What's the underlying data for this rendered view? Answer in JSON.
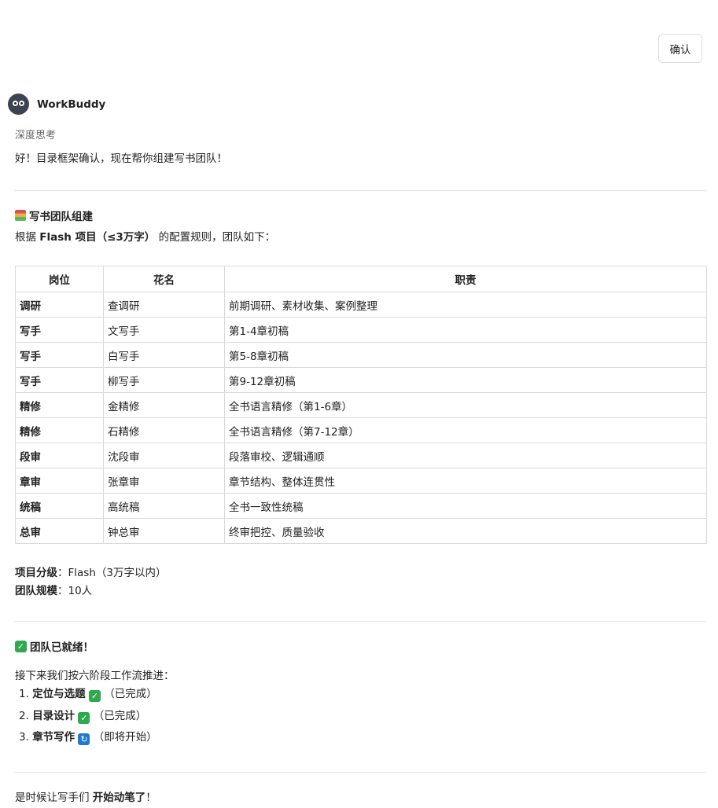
{
  "confirm_button": "确认",
  "agent": {
    "name": "WorkBuddy",
    "thinking_label": "深度思考"
  },
  "intro": "好！目录框架确认，现在帮你组建写书团队！",
  "team_section": {
    "title": "写书团队组建",
    "desc_prefix": "根据 ",
    "desc_bold": "Flash 项目（≤3万字）",
    "desc_suffix": " 的配置规则，团队如下："
  },
  "table": {
    "headers": [
      "岗位",
      "花名",
      "职责"
    ],
    "rows": [
      [
        "调研",
        "查调研",
        "前期调研、素材收集、案例整理"
      ],
      [
        "写手",
        "文写手",
        "第1-4章初稿"
      ],
      [
        "写手",
        "白写手",
        "第5-8章初稿"
      ],
      [
        "写手",
        "柳写手",
        "第9-12章初稿"
      ],
      [
        "精修",
        "金精修",
        "全书语言精修（第1-6章）"
      ],
      [
        "精修",
        "石精修",
        "全书语言精修（第7-12章）"
      ],
      [
        "段审",
        "沈段审",
        "段落审校、逻辑通顺"
      ],
      [
        "章审",
        "张章审",
        "章节结构、整体连贯性"
      ],
      [
        "统稿",
        "高统稿",
        "全书一致性统稿"
      ],
      [
        "总审",
        "钟总审",
        "终审把控、质量验收"
      ]
    ]
  },
  "project_info": {
    "level_label": "项目分级",
    "level_value": "：Flash（3万字以内）",
    "size_label": "团队规模",
    "size_value": "：10人"
  },
  "ready": {
    "title": "团队已就绪！",
    "workflow_intro": "接下来我们按六阶段工作流推进：",
    "steps": [
      {
        "num": "1.",
        "name": "定位与选题",
        "icon": "check-icon",
        "status": "（已完成）"
      },
      {
        "num": "2.",
        "name": "目录设计",
        "icon": "check-icon",
        "status": "（已完成）"
      },
      {
        "num": "3.",
        "name": "章节写作",
        "icon": "cycle-icon",
        "status": "（即将开始）"
      }
    ]
  },
  "closing": {
    "prefix": "是时候让写手们 ",
    "bold": "开始动笔了",
    "suffix": "！"
  },
  "colors": {
    "check": "#2fa84f",
    "cycle": "#1f78d1",
    "avatar": "#3e4352"
  }
}
